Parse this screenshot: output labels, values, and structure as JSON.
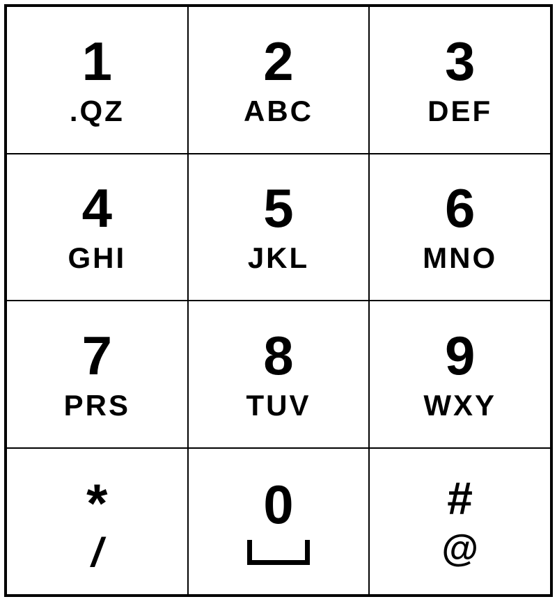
{
  "keypad": {
    "keys": [
      {
        "id": "1",
        "digit": "1",
        "letters": ".QZ"
      },
      {
        "id": "2",
        "digit": "2",
        "letters": "ABC"
      },
      {
        "id": "3",
        "digit": "3",
        "letters": "DEF"
      },
      {
        "id": "4",
        "digit": "4",
        "letters": "GHI"
      },
      {
        "id": "5",
        "digit": "5",
        "letters": "JKL"
      },
      {
        "id": "6",
        "digit": "6",
        "letters": "MNO"
      },
      {
        "id": "7",
        "digit": "7",
        "letters": "PRS"
      },
      {
        "id": "8",
        "digit": "8",
        "letters": "TUV"
      },
      {
        "id": "9",
        "digit": "9",
        "letters": "WXY"
      },
      {
        "id": "star",
        "digit": "*",
        "letters": "/"
      },
      {
        "id": "0",
        "digit": "0",
        "letters": "space"
      },
      {
        "id": "hash",
        "digit": "#",
        "letters": "@"
      }
    ]
  }
}
